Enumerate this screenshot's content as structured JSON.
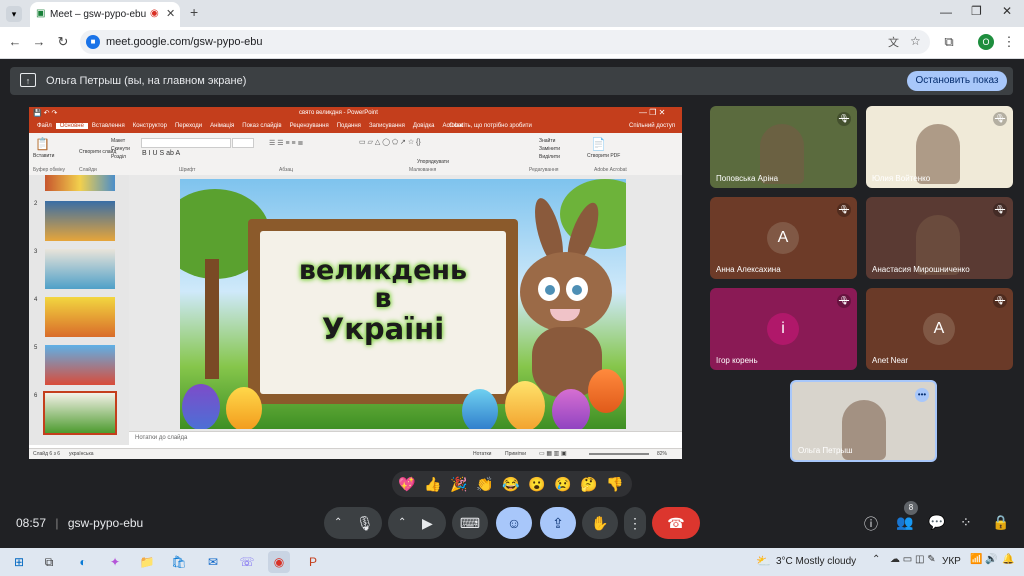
{
  "browser": {
    "tab_title": "Meet – gsw-pypo-ebu",
    "url": "meet.google.com/gsw-pypo-ebu",
    "profile_initial": "O"
  },
  "presentation_bar": {
    "presenter_text": "Ольга Петрыш (вы, на главном экране)",
    "stop_label": "Остановить показ"
  },
  "powerpoint": {
    "window_title": "свято великдня - PowerPoint",
    "menu": [
      "Файл",
      "Основне",
      "Вставлення",
      "Конструктор",
      "Переходи",
      "Анімація",
      "Показ слайдів",
      "Рецензування",
      "Подання",
      "Записування",
      "Довідка",
      "Acrobat"
    ],
    "tell_me": "Скажіть, що потрібно зробити",
    "share": "Спільний доступ",
    "ribbon_groups": [
      "Буфер обміну",
      "Слайди",
      "Шрифт",
      "Абзац",
      "Малювання",
      "Редагування",
      "Adobe Acrobat"
    ],
    "ribbon_buttons": {
      "paste": "Вставити",
      "new_slide": "Створити слайд",
      "layout": "Макет",
      "reset": "Скинути",
      "section": "Розділ",
      "arrange": "Упорядкувати",
      "find": "Знайти",
      "replace": "Замінити",
      "select": "Виділити",
      "create_pdf": "Створити PDF"
    },
    "slide_numbers": [
      "2",
      "3",
      "4",
      "5",
      "6"
    ],
    "slide_text": [
      "великдень",
      "в",
      "Україні"
    ],
    "notes": "Нотатки до слайда",
    "status_left": "Слайд 6 з 6",
    "language": "українська",
    "status_notes": "Нотатки",
    "status_comments": "Примітки",
    "zoom": "82%"
  },
  "participants": [
    {
      "name": "Поповська Аріна",
      "bg": "#5b6b3e"
    },
    {
      "name": "Юлия Войтенко",
      "bg": "#f0ead8"
    },
    {
      "name": "Анна Алексахина",
      "bg": "#6d3b28",
      "initial": "A",
      "avatar_color": "#805845"
    },
    {
      "name": "Анастасия Мирошниченко",
      "bg": "#5a3a33"
    },
    {
      "name": "Ігор корень",
      "bg": "#8a1a55",
      "initial": "i",
      "avatar_color": "#b0186a"
    },
    {
      "name": "Anet Near",
      "bg": "#6a3a28",
      "initial": "A",
      "avatar_color": "#805845"
    },
    {
      "name": "Ольга Петрыш",
      "bg": "#d8d4cc"
    }
  ],
  "reactions": [
    "💖",
    "👍",
    "🎉",
    "👏",
    "😂",
    "😮",
    "😢",
    "🤔",
    "👎"
  ],
  "bottom": {
    "time": "08:57",
    "meeting_code": "gsw-pypo-ebu",
    "people_count": "8"
  },
  "taskbar": {
    "weather": "3°C  Mostly cloudy",
    "lang": "УКР"
  }
}
